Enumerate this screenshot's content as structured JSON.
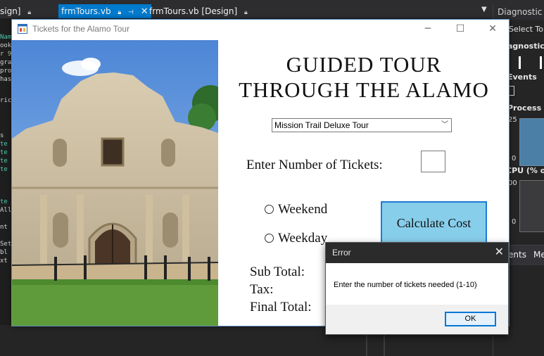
{
  "ide": {
    "tabs": [
      {
        "label": "sign]"
      },
      {
        "label": "frmTours.vb"
      },
      {
        "label": "frmTours.vb [Design]"
      }
    ],
    "diagnostic_title": "Diagnostic To",
    "diag_labels": [
      "Select To",
      "agnostics",
      "Events",
      "Process M",
      "25",
      "0",
      "CPU (% of",
      "00",
      "0"
    ],
    "bottom_tabs": [
      "ents",
      "Me"
    ],
    "code_fragments": [
      "Nam",
      "ook",
      "r 9",
      "gra",
      "pro",
      "has",
      "ric",
      "s",
      "te",
      "te",
      "te",
      "te",
      "te",
      "All",
      "nt",
      "Set",
      "bl",
      "xt"
    ]
  },
  "form": {
    "title": "Tickets for the Alamo Tour",
    "heading_line1": "GUIDED TOUR",
    "heading_line2": "THROUGH THE ALAMO",
    "tour_select": "Mission Trail Deluxe Tour",
    "tickets_label": "Enter Number of Tickets:",
    "tickets_value": "",
    "weekend_label": "Weekend",
    "weekday_label": "Weekday",
    "calculate_label": "Calculate Cost",
    "subtotal_label": "Sub Total:",
    "tax_label": "Tax:",
    "final_total_label": "Final Total:"
  },
  "dialog": {
    "title": "Error",
    "message": "Enter the number of tickets needed (1-10)",
    "ok_label": "OK"
  },
  "colors": {
    "ide_background": "#1e1e1e",
    "active_tab": "#007acc",
    "calculate_button": "#87ceeb",
    "calculate_border": "#1e7bd4"
  },
  "icons": [
    "lock-icon",
    "pin-icon",
    "close-icon",
    "minimize-icon",
    "maximize-icon",
    "form-app-icon",
    "dropdown-chevron-icon"
  ]
}
